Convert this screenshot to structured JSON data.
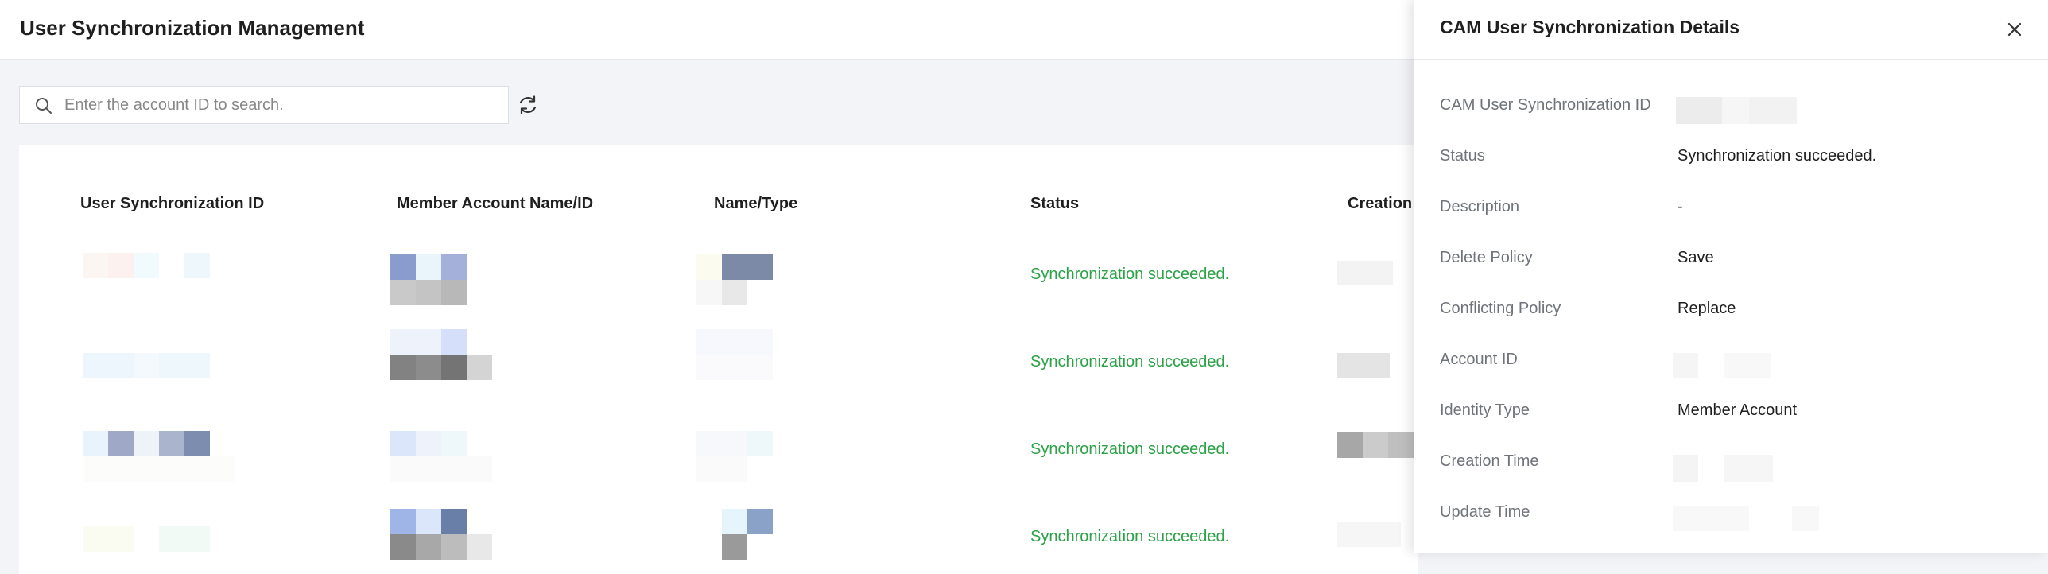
{
  "header": {
    "title": "User Synchronization Management"
  },
  "search": {
    "placeholder": "Enter the account ID to search.",
    "value": ""
  },
  "table": {
    "columns": [
      "User Synchronization ID",
      "Member Account Name/ID",
      "Name/Type",
      "Status",
      "Creation"
    ],
    "rows": [
      {
        "status": "Synchronization succeeded."
      },
      {
        "status": "Synchronization succeeded."
      },
      {
        "status": "Synchronization succeeded."
      },
      {
        "status": "Synchronization succeeded."
      }
    ]
  },
  "drawer": {
    "title": "CAM User Synchronization Details",
    "fields": [
      {
        "label": "CAM User Synchronization ID",
        "value": ""
      },
      {
        "label": "Status",
        "value": "Synchronization succeeded."
      },
      {
        "label": "Description",
        "value": "-"
      },
      {
        "label": "Delete Policy",
        "value": "Save"
      },
      {
        "label": "Conflicting Policy",
        "value": "Replace"
      },
      {
        "label": "Account ID",
        "value": ""
      },
      {
        "label": "Identity Type",
        "value": "Member Account"
      },
      {
        "label": "Creation Time",
        "value": ""
      },
      {
        "label": "Update Time",
        "value": ""
      }
    ]
  },
  "colors": {
    "success": "#2ba246",
    "label": "#6f737a",
    "page_background": "#f3f4f7"
  },
  "icons": [
    "search-icon",
    "refresh-icon",
    "close-icon"
  ]
}
